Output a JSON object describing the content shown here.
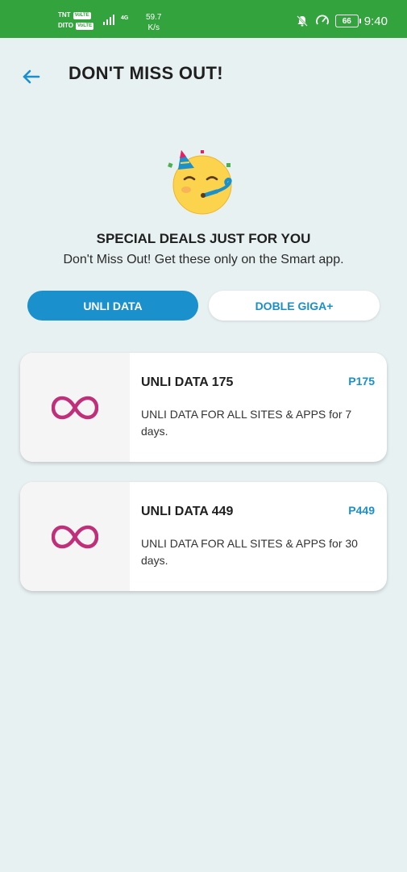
{
  "status_bar": {
    "carrier_1": "TNT",
    "carrier_2": "DITO",
    "volte_label": "VoLTE",
    "network_type": "4G",
    "speed_value": "59.7",
    "speed_unit": "K/s",
    "battery": "66",
    "time": "9:40",
    "icons": [
      "bell-off-icon",
      "speedometer-icon",
      "battery-icon"
    ]
  },
  "header": {
    "back_icon": "arrow-left-icon",
    "title": "DON'T MISS OUT!"
  },
  "hero": {
    "emoji_icon": "party-face-emoji",
    "title": "SPECIAL DEALS JUST FOR YOU",
    "subtitle": "Don't Miss Out! Get these only on the Smart app."
  },
  "tabs": [
    {
      "label": "UNLI DATA",
      "active": true
    },
    {
      "label": "DOBLE GIGA+",
      "active": false
    }
  ],
  "offers": [
    {
      "name": "UNLI DATA 175",
      "price": "P175",
      "description": "UNLI DATA FOR ALL SITES & APPS for 7 days.",
      "icon": "infinity-icon"
    },
    {
      "name": "UNLI DATA 449",
      "price": "P449",
      "description": "UNLI DATA FOR ALL SITES & APPS for 30 days.",
      "icon": "infinity-icon"
    }
  ],
  "colors": {
    "status_bar": "#33a33d",
    "background": "#e8f1f2",
    "accent": "#1a90cd",
    "infinity": "#c0307a"
  }
}
